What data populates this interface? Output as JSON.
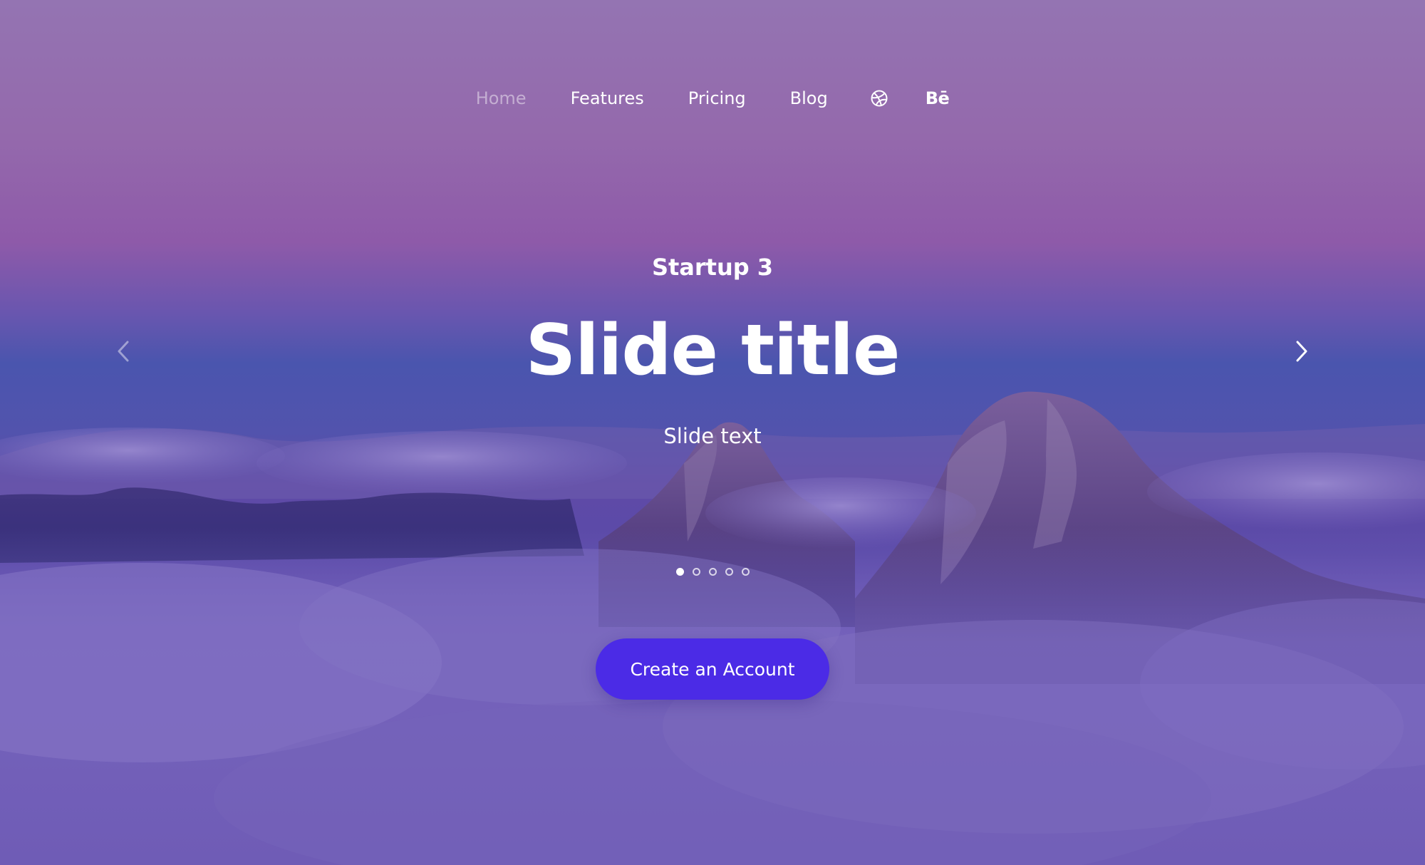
{
  "nav": {
    "items": [
      {
        "label": "Home",
        "active": true
      },
      {
        "label": "Features",
        "active": false
      },
      {
        "label": "Pricing",
        "active": false
      },
      {
        "label": "Blog",
        "active": false
      }
    ],
    "icons": {
      "dribbble": "dribbble-icon",
      "behance": "Bē"
    }
  },
  "hero": {
    "eyebrow": "Startup 3",
    "title": "Slide title",
    "text": "Slide text",
    "cta_label": "Create an Account",
    "slides_total": 5,
    "active_slide": 1
  },
  "colors": {
    "cta": "#4b2be6",
    "text": "#ffffff",
    "nav_active": "rgba(255,255,255,0.45)"
  }
}
